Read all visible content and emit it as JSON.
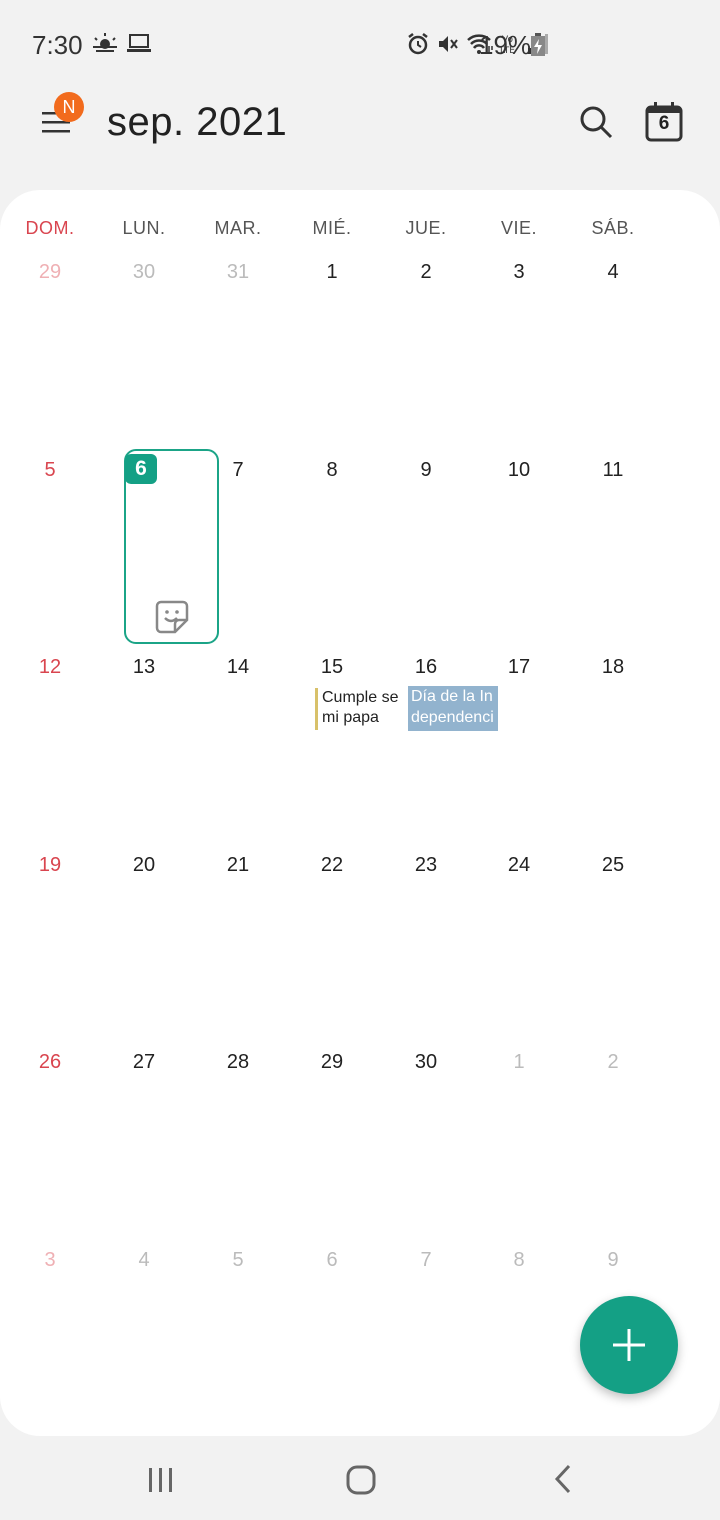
{
  "status": {
    "time": "7:30",
    "battery": "19%"
  },
  "header": {
    "title": "sep. 2021",
    "badge": "N",
    "today_number": "6"
  },
  "weekdays": [
    "DOM.",
    "LUN.",
    "MAR.",
    "MIÉ.",
    "JUE.",
    "VIE.",
    "SÁB."
  ],
  "weeks": [
    [
      "29",
      "30",
      "31",
      "1",
      "2",
      "3",
      "4"
    ],
    [
      "5",
      "6",
      "7",
      "8",
      "9",
      "10",
      "11"
    ],
    [
      "12",
      "13",
      "14",
      "15",
      "16",
      "17",
      "18"
    ],
    [
      "19",
      "20",
      "21",
      "22",
      "23",
      "24",
      "25"
    ],
    [
      "26",
      "27",
      "28",
      "29",
      "30",
      "1",
      "2"
    ],
    [
      "3",
      "4",
      "5",
      "6",
      "7",
      "8",
      "9"
    ]
  ],
  "events": {
    "cumple": "Cumple se mi papa",
    "independencia": "Día de la Independencia"
  },
  "colors": {
    "accent": "#14a085",
    "sunday": "#d9454f",
    "event_bar": "#d8c16a",
    "holiday": "#92b3ce"
  }
}
